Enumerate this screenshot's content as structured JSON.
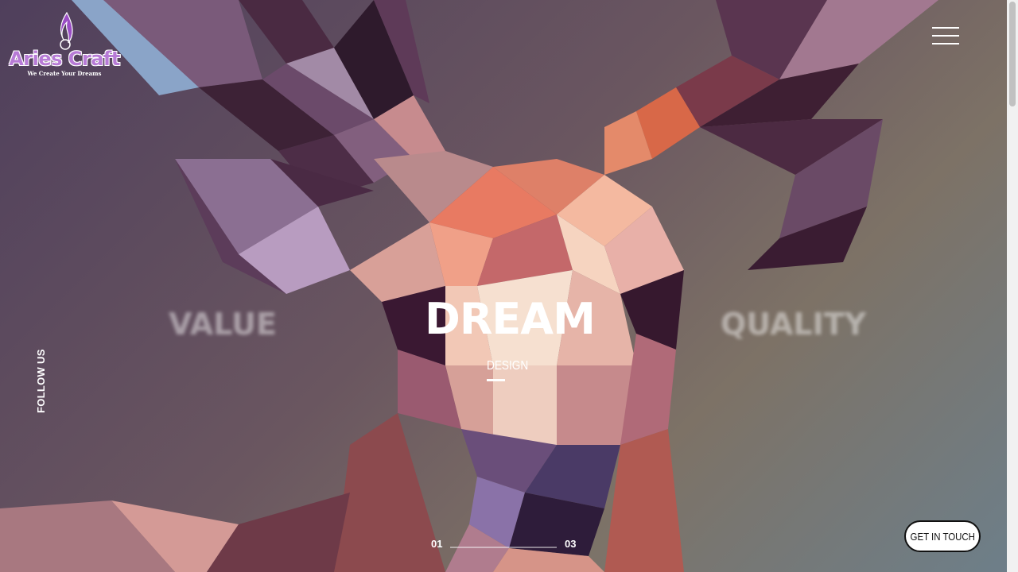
{
  "brand": {
    "name": "Aries Craft",
    "tagline": "We Create Your Dreams",
    "color": "#b77bd6"
  },
  "nav": {
    "menu_icon": "hamburger-menu-icon"
  },
  "slider": {
    "prev_word": "VALUE",
    "current_word": "DREAM",
    "next_word": "QUALITY",
    "current_label": "DESIGN",
    "page_start": "01",
    "page_end": "03",
    "progress": 0.0
  },
  "social": {
    "follow_label": "FOLLOW US"
  },
  "cta": {
    "label": "GET IN TOUCH"
  },
  "colors": {
    "accent": "#ffffff",
    "background_start": "#4f3f5c",
    "background_end": "#6d7f8a"
  }
}
